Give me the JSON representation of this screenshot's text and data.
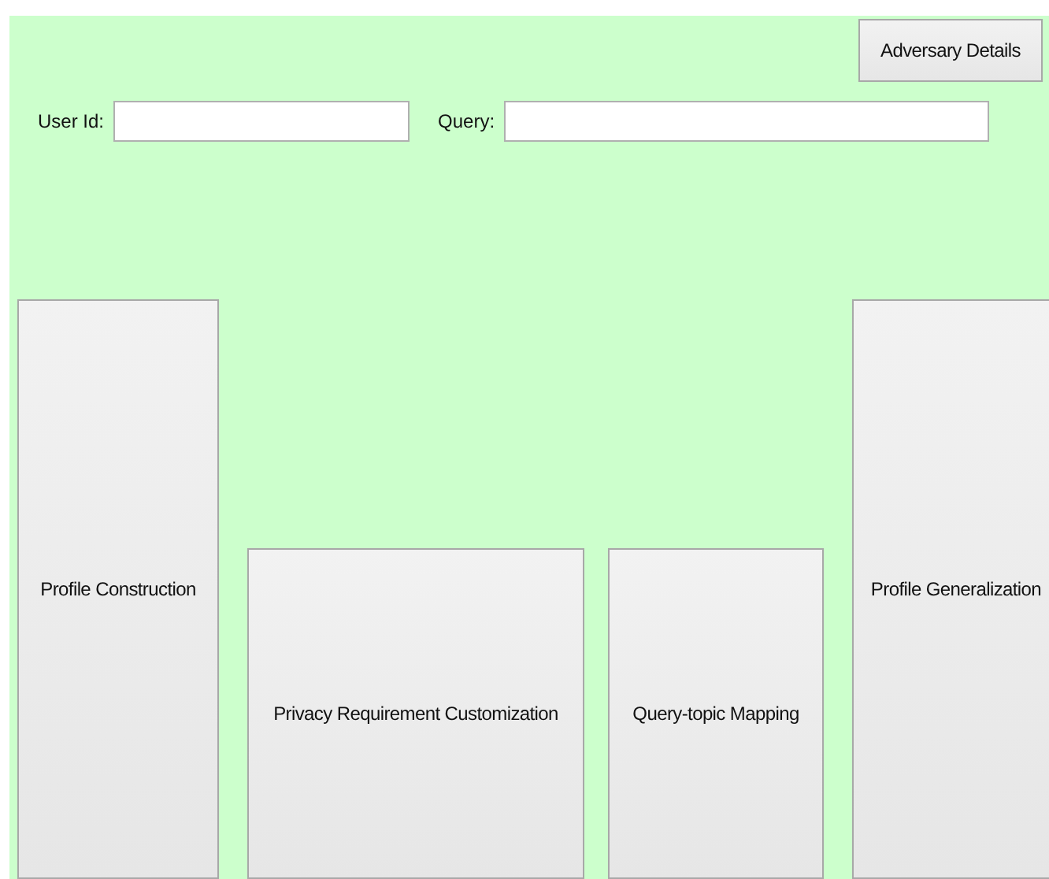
{
  "top_button": "Adversary Details",
  "fields": [
    {
      "label": "User Id:"
    },
    {
      "label": "Query:"
    }
  ],
  "actions": [
    {
      "label": "Profile Construction",
      "kind": "tall"
    },
    {
      "label": "Privacy Requirement Customization",
      "kind": "short"
    },
    {
      "label": "Query-topic Mapping",
      "kind": "short"
    },
    {
      "label": "Profile Generalization",
      "kind": "tall"
    }
  ]
}
